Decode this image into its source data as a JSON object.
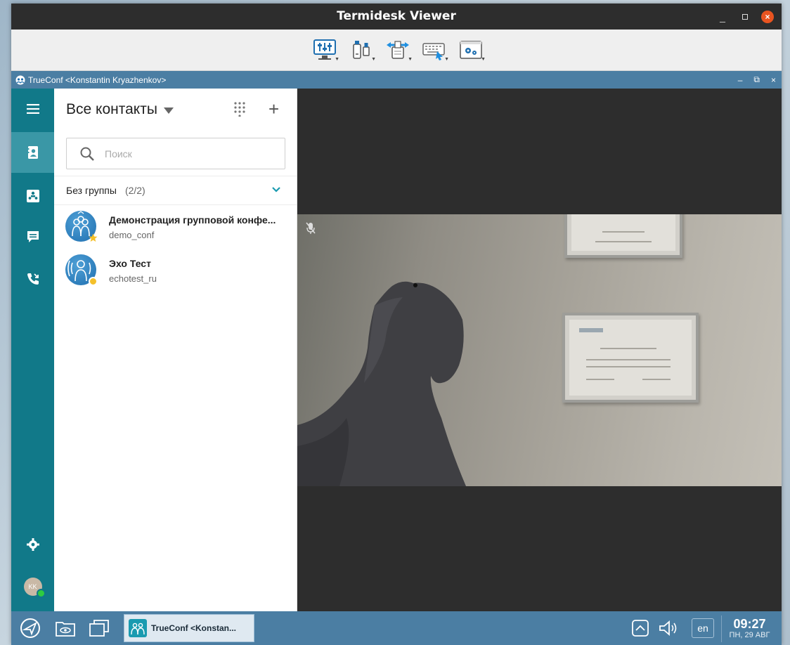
{
  "window": {
    "title": "Termidesk Viewer",
    "minimize_glyph": "_",
    "close_glyph": "×"
  },
  "toolbar": {
    "buttons": [
      {
        "icon": "equalizer-settings-icon"
      },
      {
        "icon": "usb-devices-icon"
      },
      {
        "icon": "clipboard-transfer-icon"
      },
      {
        "icon": "keyboard-input-icon"
      },
      {
        "icon": "viewer-settings-icon"
      }
    ]
  },
  "trueconf_window": {
    "title": "TrueConf <Konstantin Kryazhenkov>",
    "controls": {
      "minimize": "–",
      "restore": "⧉",
      "close": "×"
    }
  },
  "nav": {
    "items": [
      {
        "icon": "menu-icon"
      },
      {
        "icon": "contacts-book-icon",
        "active": true
      },
      {
        "icon": "conferences-icon"
      },
      {
        "icon": "chat-icon"
      },
      {
        "icon": "call-history-icon"
      },
      {
        "icon": "settings-gear-icon"
      },
      {
        "icon": "user-avatar-icon",
        "initials": "KK",
        "status_color": "#2ecc40"
      }
    ]
  },
  "contacts": {
    "header": "Все контакты",
    "search_placeholder": "Поиск",
    "group": {
      "name": "Без группы",
      "count": "(2/2)"
    },
    "items": [
      {
        "name": "Демонстрация групповой конфе...",
        "login": "demo_conf",
        "badge_color": "#f4c02a"
      },
      {
        "name": "Эхо Тест",
        "login": "echotest_ru",
        "badge_color": "#f4c02a"
      }
    ]
  },
  "video": {
    "mic_muted": true
  },
  "taskbar": {
    "app_label": "TrueConf <Konstan...",
    "lang": "en",
    "time": "09:27",
    "date": "ПН, 29 АВГ"
  },
  "colors": {
    "nav_bg": "#117989",
    "nav_active": "#3a97a6",
    "titlebar_bg": "#2d2d2d",
    "window_bar": "#4b7ea3",
    "accent": "#1a9bb0"
  }
}
